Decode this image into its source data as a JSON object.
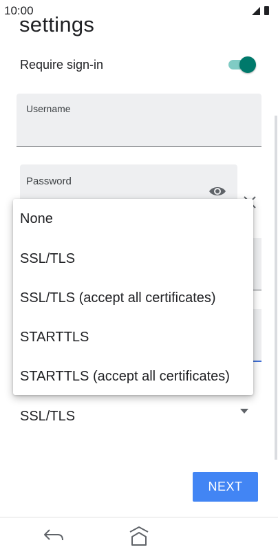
{
  "status_bar": {
    "time": "10:00",
    "icons": [
      "signal-icon",
      "battery-icon"
    ]
  },
  "page": {
    "title": "settings"
  },
  "require_signin": {
    "label": "Require sign-in",
    "enabled": true
  },
  "username": {
    "label": "Username",
    "value": ""
  },
  "password": {
    "label": "Password",
    "value": ""
  },
  "security_menu": {
    "options": [
      "None",
      "SSL/TLS",
      "SSL/TLS (accept all certificates)",
      "STARTTLS",
      "STARTTLS (accept all certificates)"
    ]
  },
  "security": {
    "value": "SSL/TLS"
  },
  "actions": {
    "next_label": "NEXT"
  },
  "colors": {
    "accent": "#00796b",
    "button": "#4285f4"
  }
}
